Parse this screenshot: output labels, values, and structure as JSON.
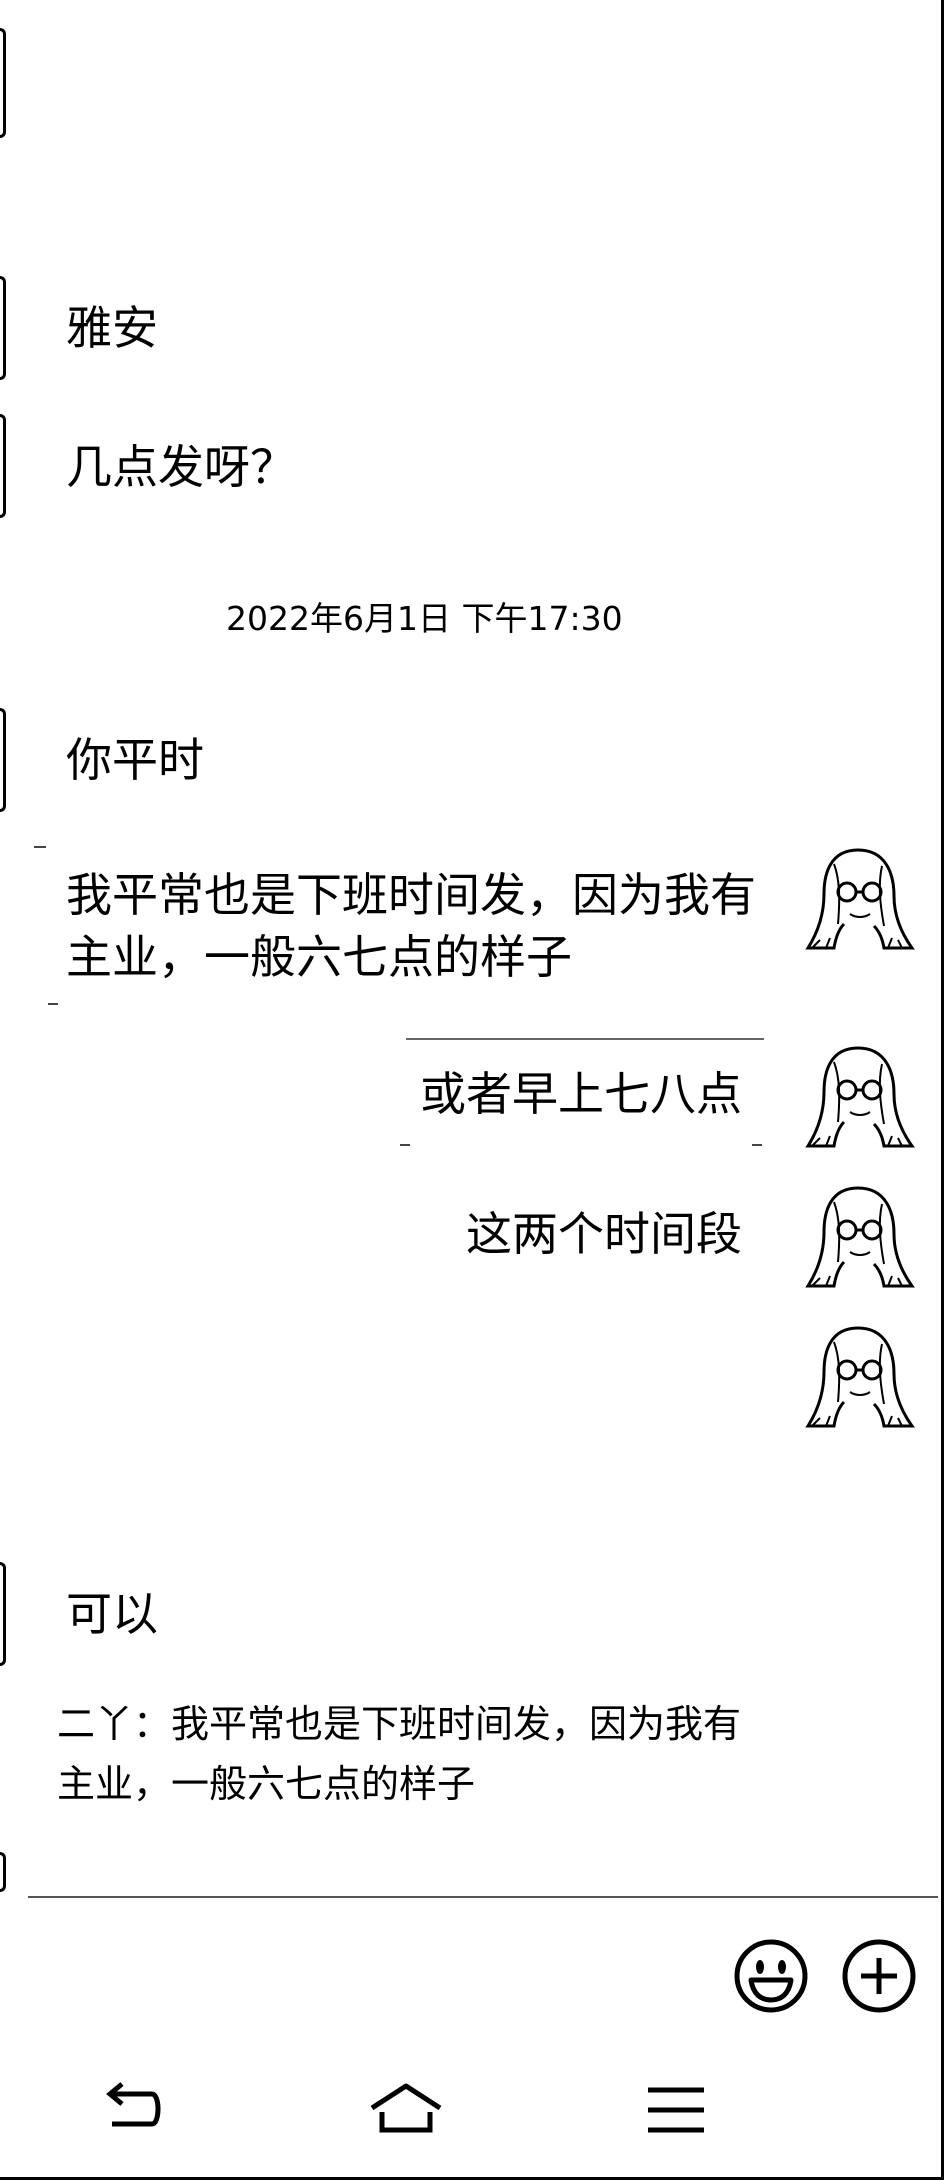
{
  "chat": {
    "messages": [
      {
        "text": "雅安"
      },
      {
        "text": "几点发呀？"
      },
      {
        "text": "你平时"
      },
      {
        "text": "我平常也是下班时间发，因为我有主业，一般六七点的样子"
      },
      {
        "text": "或者早上七八点"
      },
      {
        "text": "这两个时间段"
      },
      {
        "text": "可以"
      }
    ],
    "timestamp": "2022年6月1日 下午17:30",
    "quote": {
      "text": "二丫：我平常也是下班时间发，因为我有主业，一般六七点的样子"
    }
  },
  "input_bar": {
    "emoji_icon": "emoji-smile-icon",
    "plus_icon": "plus-circle-icon"
  },
  "nav_bar": {
    "back_icon": "back-arrow-icon",
    "home_icon": "home-icon",
    "menu_icon": "menu-icon"
  }
}
